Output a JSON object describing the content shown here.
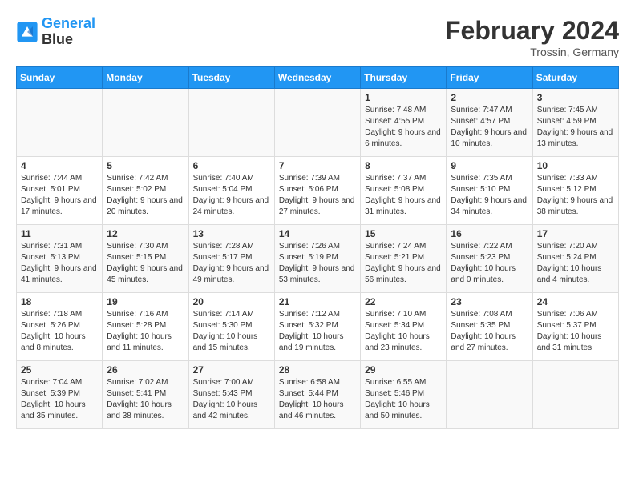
{
  "header": {
    "logo_line1": "General",
    "logo_line2": "Blue",
    "main_title": "February 2024",
    "subtitle": "Trossin, Germany"
  },
  "days_of_week": [
    "Sunday",
    "Monday",
    "Tuesday",
    "Wednesday",
    "Thursday",
    "Friday",
    "Saturday"
  ],
  "weeks": [
    [
      {
        "day": "",
        "info": ""
      },
      {
        "day": "",
        "info": ""
      },
      {
        "day": "",
        "info": ""
      },
      {
        "day": "",
        "info": ""
      },
      {
        "day": "1",
        "info": "Sunrise: 7:48 AM\nSunset: 4:55 PM\nDaylight: 9 hours and 6 minutes."
      },
      {
        "day": "2",
        "info": "Sunrise: 7:47 AM\nSunset: 4:57 PM\nDaylight: 9 hours and 10 minutes."
      },
      {
        "day": "3",
        "info": "Sunrise: 7:45 AM\nSunset: 4:59 PM\nDaylight: 9 hours and 13 minutes."
      }
    ],
    [
      {
        "day": "4",
        "info": "Sunrise: 7:44 AM\nSunset: 5:01 PM\nDaylight: 9 hours and 17 minutes."
      },
      {
        "day": "5",
        "info": "Sunrise: 7:42 AM\nSunset: 5:02 PM\nDaylight: 9 hours and 20 minutes."
      },
      {
        "day": "6",
        "info": "Sunrise: 7:40 AM\nSunset: 5:04 PM\nDaylight: 9 hours and 24 minutes."
      },
      {
        "day": "7",
        "info": "Sunrise: 7:39 AM\nSunset: 5:06 PM\nDaylight: 9 hours and 27 minutes."
      },
      {
        "day": "8",
        "info": "Sunrise: 7:37 AM\nSunset: 5:08 PM\nDaylight: 9 hours and 31 minutes."
      },
      {
        "day": "9",
        "info": "Sunrise: 7:35 AM\nSunset: 5:10 PM\nDaylight: 9 hours and 34 minutes."
      },
      {
        "day": "10",
        "info": "Sunrise: 7:33 AM\nSunset: 5:12 PM\nDaylight: 9 hours and 38 minutes."
      }
    ],
    [
      {
        "day": "11",
        "info": "Sunrise: 7:31 AM\nSunset: 5:13 PM\nDaylight: 9 hours and 41 minutes."
      },
      {
        "day": "12",
        "info": "Sunrise: 7:30 AM\nSunset: 5:15 PM\nDaylight: 9 hours and 45 minutes."
      },
      {
        "day": "13",
        "info": "Sunrise: 7:28 AM\nSunset: 5:17 PM\nDaylight: 9 hours and 49 minutes."
      },
      {
        "day": "14",
        "info": "Sunrise: 7:26 AM\nSunset: 5:19 PM\nDaylight: 9 hours and 53 minutes."
      },
      {
        "day": "15",
        "info": "Sunrise: 7:24 AM\nSunset: 5:21 PM\nDaylight: 9 hours and 56 minutes."
      },
      {
        "day": "16",
        "info": "Sunrise: 7:22 AM\nSunset: 5:23 PM\nDaylight: 10 hours and 0 minutes."
      },
      {
        "day": "17",
        "info": "Sunrise: 7:20 AM\nSunset: 5:24 PM\nDaylight: 10 hours and 4 minutes."
      }
    ],
    [
      {
        "day": "18",
        "info": "Sunrise: 7:18 AM\nSunset: 5:26 PM\nDaylight: 10 hours and 8 minutes."
      },
      {
        "day": "19",
        "info": "Sunrise: 7:16 AM\nSunset: 5:28 PM\nDaylight: 10 hours and 11 minutes."
      },
      {
        "day": "20",
        "info": "Sunrise: 7:14 AM\nSunset: 5:30 PM\nDaylight: 10 hours and 15 minutes."
      },
      {
        "day": "21",
        "info": "Sunrise: 7:12 AM\nSunset: 5:32 PM\nDaylight: 10 hours and 19 minutes."
      },
      {
        "day": "22",
        "info": "Sunrise: 7:10 AM\nSunset: 5:34 PM\nDaylight: 10 hours and 23 minutes."
      },
      {
        "day": "23",
        "info": "Sunrise: 7:08 AM\nSunset: 5:35 PM\nDaylight: 10 hours and 27 minutes."
      },
      {
        "day": "24",
        "info": "Sunrise: 7:06 AM\nSunset: 5:37 PM\nDaylight: 10 hours and 31 minutes."
      }
    ],
    [
      {
        "day": "25",
        "info": "Sunrise: 7:04 AM\nSunset: 5:39 PM\nDaylight: 10 hours and 35 minutes."
      },
      {
        "day": "26",
        "info": "Sunrise: 7:02 AM\nSunset: 5:41 PM\nDaylight: 10 hours and 38 minutes."
      },
      {
        "day": "27",
        "info": "Sunrise: 7:00 AM\nSunset: 5:43 PM\nDaylight: 10 hours and 42 minutes."
      },
      {
        "day": "28",
        "info": "Sunrise: 6:58 AM\nSunset: 5:44 PM\nDaylight: 10 hours and 46 minutes."
      },
      {
        "day": "29",
        "info": "Sunrise: 6:55 AM\nSunset: 5:46 PM\nDaylight: 10 hours and 50 minutes."
      },
      {
        "day": "",
        "info": ""
      },
      {
        "day": "",
        "info": ""
      }
    ]
  ]
}
